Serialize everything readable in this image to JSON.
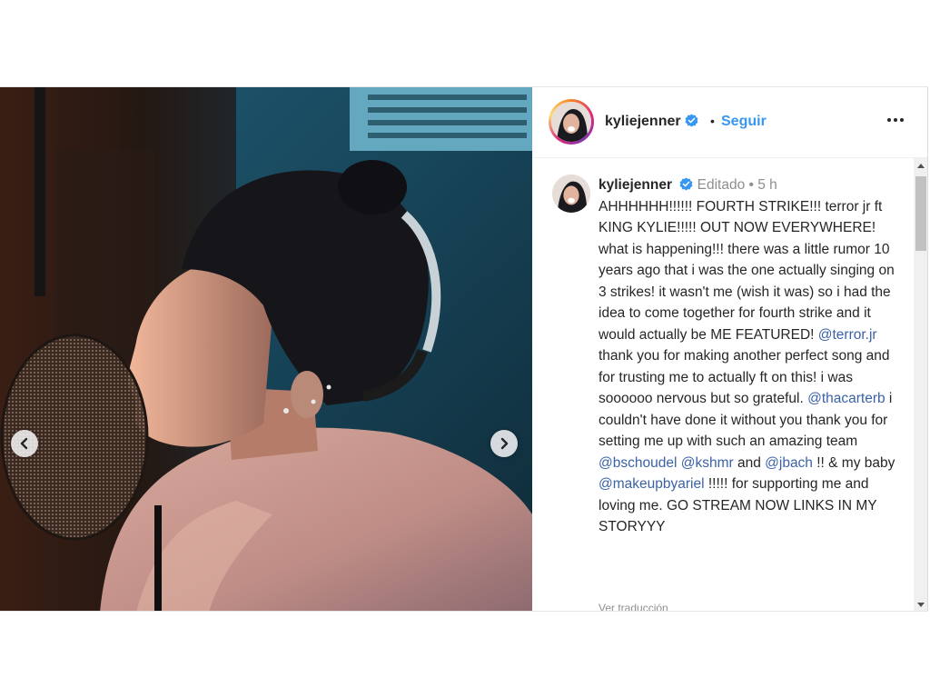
{
  "header": {
    "username": "kyliejenner",
    "dot": "•",
    "follow_label": "Seguir"
  },
  "caption": {
    "username": "kyliejenner",
    "meta": "Editado • 5 h",
    "part1": "AHHHHHH!!!!!! FOURTH STRIKE!!! terror jr ft KING KYLIE!!!!! OUT NOW EVERYWHERE! what is happening!!! there was a little rumor 10 years ago that i was the one actually singing on 3 strikes! it wasn't me (wish it was) so i had the idea to come together for fourth strike and it would actually be ME FEATURED! ",
    "mention1": "@terror.jr",
    "part2": " thank you for making another perfect song and for trusting me to actually ft on this! i was soooooo nervous but so grateful. ",
    "mention2": "@thacarterb",
    "part3": " i couldn't have done it without you thank you for setting me up with such an amazing team ",
    "mention3": "@bschoudel",
    "mention4": "@kshmr",
    "and": " and ",
    "mention5": "@jbach",
    "part4": " !! & my baby ",
    "mention6": "@makeupbyariel",
    "part5": " !!!!! for supporting me and loving me. GO STREAM NOW LINKS IN MY STORYYY",
    "translate": "Ver traducción"
  },
  "icons": {
    "verified": "verified-badge-icon",
    "prev": "chevron-left-icon",
    "next": "chevron-right-icon",
    "more": "more-options-icon"
  },
  "colors": {
    "link": "#3b62a6",
    "follow": "#3897f0",
    "verified": "#3897f0",
    "muted": "#8e8e8e"
  }
}
